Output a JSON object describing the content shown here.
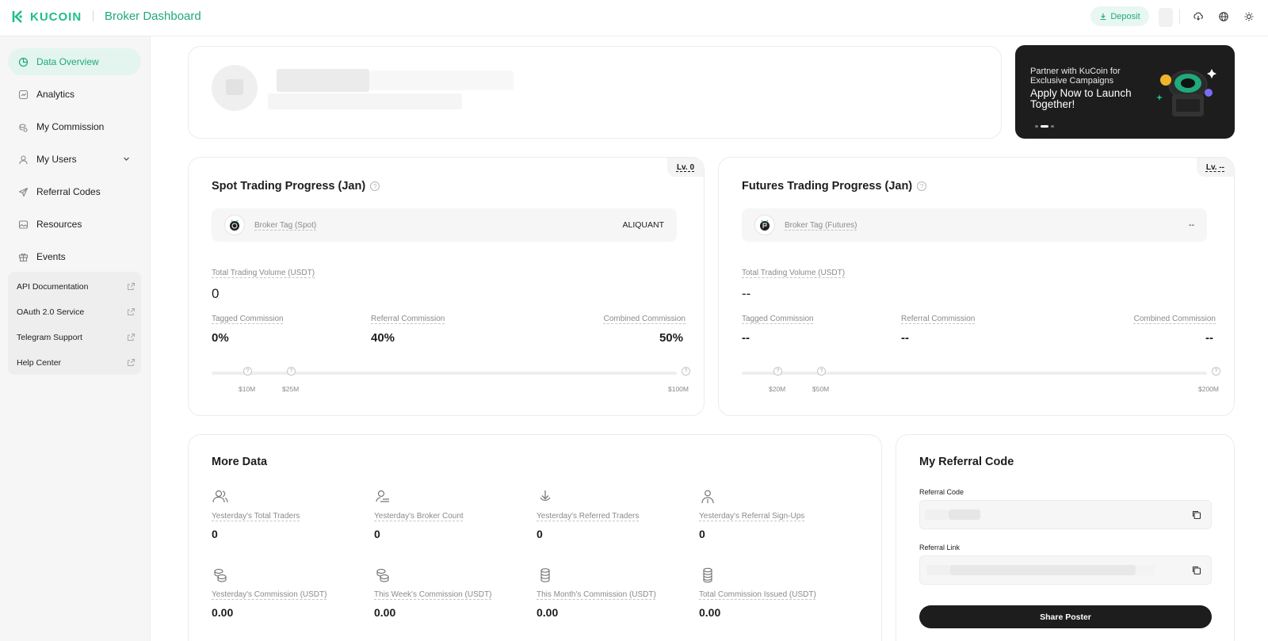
{
  "header": {
    "brand": "KUCOIN",
    "title": "Broker Dashboard",
    "deposit_label": "Deposit",
    "icons": [
      "download-icon",
      "globe-icon",
      "sun-icon"
    ]
  },
  "sidebar": {
    "items": [
      {
        "label": "Data Overview",
        "icon": "chart-pie-icon",
        "active": true
      },
      {
        "label": "Analytics",
        "icon": "analytics-icon"
      },
      {
        "label": "My Commission",
        "icon": "commission-icon"
      },
      {
        "label": "My Users",
        "icon": "user-icon",
        "expandable": true
      },
      {
        "label": "Referral Codes",
        "icon": "send-icon"
      },
      {
        "label": "Resources",
        "icon": "image-icon"
      },
      {
        "label": "Events",
        "icon": "gift-icon"
      }
    ],
    "external_links": [
      {
        "label": "API Documentation"
      },
      {
        "label": "OAuth 2.0 Service"
      },
      {
        "label": "Telegram Support"
      },
      {
        "label": "Help Center"
      }
    ]
  },
  "promo": {
    "small_text": "Partner with KuCoin for Exclusive Campaigns",
    "big_text": "Apply Now to Launch Together!"
  },
  "spot": {
    "title": "Spot Trading Progress (Jan)",
    "level": "Lv. 0",
    "tag_label": "Broker Tag (Spot)",
    "tag_value": "ALIQUANT",
    "volume_label": "Total Trading Volume (USDT)",
    "volume_value": "0",
    "tagged_label": "Tagged Commission",
    "tagged_value": "0%",
    "referral_label": "Referral Commission",
    "referral_value": "40%",
    "combined_label": "Combined Commission",
    "combined_value": "50%",
    "milestones": [
      "$10M",
      "$25M",
      "$100M"
    ]
  },
  "futures": {
    "title": "Futures Trading Progress (Jan)",
    "level": "Lv. --",
    "tag_label": "Broker Tag (Futures)",
    "tag_value": "--",
    "volume_label": "Total Trading Volume (USDT)",
    "volume_value": "--",
    "tagged_label": "Tagged Commission",
    "tagged_value": "--",
    "referral_label": "Referral Commission",
    "referral_value": "--",
    "combined_label": "Combined Commission",
    "combined_value": "--",
    "milestones": [
      "$20M",
      "$50M",
      "$200M"
    ]
  },
  "more_data": {
    "title": "More Data",
    "stats": [
      {
        "label": "Yesterday's Total Traders",
        "value": "0",
        "icon": "users-icon"
      },
      {
        "label": "Yesterday's Broker Count",
        "value": "0",
        "icon": "broker-icon"
      },
      {
        "label": "Yesterday's Referred Traders",
        "value": "0",
        "icon": "download-arrow-icon"
      },
      {
        "label": "Yesterday's Referral Sign-Ups",
        "value": "0",
        "icon": "person-plus-icon"
      },
      {
        "label": "Yesterday's Commission (USDT)",
        "value": "0.00",
        "icon": "coins-icon"
      },
      {
        "label": "This Week's Commission (USDT)",
        "value": "0.00",
        "icon": "coins-icon"
      },
      {
        "label": "This Month's Commission (USDT)",
        "value": "0.00",
        "icon": "coin-stack-icon"
      },
      {
        "label": "Total Commission Issued (USDT)",
        "value": "0.00",
        "icon": "coin-stack-icon"
      }
    ]
  },
  "referral": {
    "title": "My Referral Code",
    "code_label": "Referral Code",
    "link_label": "Referral Link",
    "share_label": "Share Poster"
  },
  "colors": {
    "brand_green": "#1fbf8a",
    "active_bg": "#e3f5ee",
    "dark": "#1d1d1d"
  }
}
